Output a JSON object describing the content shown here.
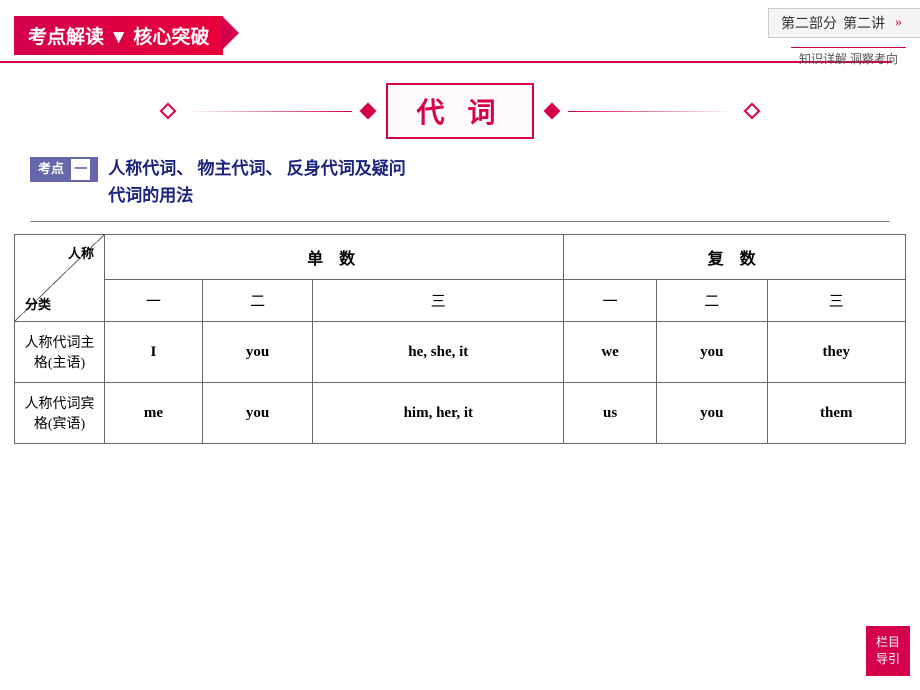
{
  "topRightLabel": {
    "part": "第二部分",
    "lecture": "第二讲"
  },
  "rightSubLabel": "知识详解  洞察考向",
  "headerTitle": "考点解读 ▼ 核心突破",
  "mainTitle": "代  词",
  "kaodianSection": {
    "badge": "考点",
    "badgeNum": "一",
    "line1": "人称代词、 物主代词、 反身代词及疑问",
    "line2": "代词的用法"
  },
  "table": {
    "headers": {
      "col1": "人称",
      "col2": "单  数",
      "col3": "复  数"
    },
    "subHeaders": {
      "diagonal_top": "人称",
      "diagonal_bottom": "分类",
      "one": "一",
      "two": "二",
      "three": "三",
      "one2": "一",
      "two2": "二",
      "three2": "三"
    },
    "rows": [
      {
        "label_line1": "人称代词主",
        "label_line2": "格(主语)",
        "cells": [
          "I",
          "you",
          "he, she, it",
          "we",
          "you",
          "they"
        ]
      },
      {
        "label_line1": "人称代词宾",
        "label_line2": "格(宾语)",
        "cells": [
          "me",
          "you",
          "him, her, it",
          "us",
          "you",
          "them"
        ]
      }
    ]
  },
  "navButton": {
    "line1": "栏目",
    "line2": "导引"
  }
}
